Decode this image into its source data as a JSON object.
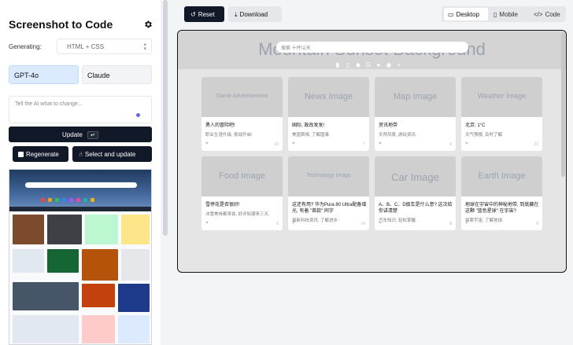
{
  "sidebar": {
    "title": "Screenshot to Code",
    "generating_label": "Generating:",
    "generating_value": "HTML + CSS",
    "models": [
      "GPT-4o",
      "Claude"
    ],
    "prompt_placeholder": "Tell the AI what to change...",
    "update_label": "Update",
    "update_kbd": "↵",
    "regenerate_label": "Regenerate",
    "select_update_label": "Select and update"
  },
  "toolbar": {
    "reset_label": "Reset",
    "download_label": "Download",
    "views": [
      "Desktop",
      "Mobile",
      "Code"
    ],
    "active_view": "Desktop"
  },
  "preview": {
    "title": "Mountain Sunset Background",
    "search_text": "搜索 十件以天",
    "cards": [
      {
        "image": "Game Advertisement",
        "title": "勇人的冒险吧!",
        "sub": "职业生涯升级, 挑战开启!",
        "count": "16"
      },
      {
        "image": "News Image",
        "title": "国际, 政改发发!",
        "sub": "美国首相, 了解国事.",
        "count": "7"
      },
      {
        "image": "Map Image",
        "title": "资讯地带",
        "sub": "天然风景, 游玩资讯.",
        "count": "4"
      },
      {
        "image": "Weather Image",
        "title": "北京: 1°C",
        "sub": "天气预报, 及时了解.",
        "count": "22"
      },
      {
        "image": "Food Image",
        "title": "雪停花是否很好!",
        "sub": "冰雪美味都来尝, 好评如潮来三天.",
        "count": "6"
      },
      {
        "image": "Technology Image",
        "title": "这还有用? 华为Pura 80 Ultra配备增光, 有着 \"首款\" 同字",
        "sub": "最新科技资讯, 了解进步.",
        "count": "14"
      },
      {
        "image": "Car Image",
        "title": "A、B、C、D级车是什么意? 这次给你讲清楚",
        "sub": "汽车知识, 轻松掌握.",
        "count": "8"
      },
      {
        "image": "Earth Image",
        "title": "地球在宇宙中的神秘地带, 到底藏在这颗 \"蓝色星球\" 在宇宙?",
        "sub": "探索宇宙, 了解地球.",
        "count": "8"
      }
    ]
  }
}
